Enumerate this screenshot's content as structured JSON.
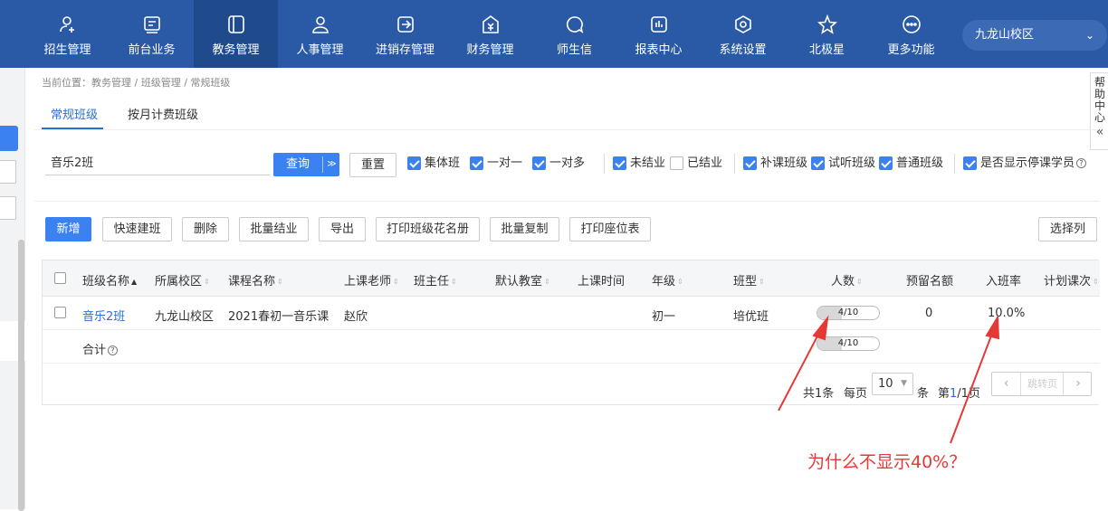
{
  "nav": {
    "items": [
      {
        "label": "招生管理",
        "icon": "user-plus-icon"
      },
      {
        "label": "前台业务",
        "icon": "reception-icon"
      },
      {
        "label": "教务管理",
        "icon": "book-icon"
      },
      {
        "label": "人事管理",
        "icon": "person-icon"
      },
      {
        "label": "进销存管理",
        "icon": "inventory-icon"
      },
      {
        "label": "财务管理",
        "icon": "finance-icon"
      },
      {
        "label": "师生信",
        "icon": "message-icon"
      },
      {
        "label": "报表中心",
        "icon": "report-icon"
      },
      {
        "label": "系统设置",
        "icon": "settings-icon"
      },
      {
        "label": "北极星",
        "icon": "star-icon"
      },
      {
        "label": "更多功能",
        "icon": "more-icon"
      }
    ],
    "active_index": 2,
    "campus": "九龙山校区"
  },
  "help": {
    "label": "帮助中心",
    "chars": [
      "帮",
      "助",
      "中",
      "心"
    ]
  },
  "breadcrumb": "当前位置：教务管理 / 班级管理 / 常规班级",
  "tabs": [
    {
      "label": "常规班级",
      "active": true
    },
    {
      "label": "按月计费班级",
      "active": false
    }
  ],
  "filters": {
    "search_value": "音乐2班",
    "query_label": "查询",
    "reset_label": "重置",
    "checks": [
      {
        "label": "集体班",
        "checked": true
      },
      {
        "label": "一对一",
        "checked": true
      },
      {
        "label": "一对多",
        "checked": true
      },
      {
        "label": "未结业",
        "checked": true
      },
      {
        "label": "已结业",
        "checked": false
      },
      {
        "label": "补课班级",
        "checked": true
      },
      {
        "label": "试听班级",
        "checked": true
      },
      {
        "label": "普通班级",
        "checked": true
      },
      {
        "label": "是否显示停课学员",
        "checked": true
      }
    ]
  },
  "toolbar": {
    "buttons": [
      "新增",
      "快速建班",
      "删除",
      "批量结业",
      "导出",
      "打印班级花名册",
      "批量复制",
      "打印座位表"
    ],
    "choose_columns": "选择列"
  },
  "table": {
    "columns": [
      "班级名称",
      "所属校区",
      "课程名称",
      "上课老师",
      "班主任",
      "默认教室",
      "上课时间",
      "年级",
      "班型",
      "人数",
      "预留名额",
      "入班率",
      "计划课次"
    ],
    "rows": [
      {
        "class_name": "音乐2班",
        "campus": "九龙山校区",
        "course": "2021春初一音乐课",
        "teacher": "赵欣",
        "head_teacher": "",
        "classroom": "",
        "time": "",
        "grade": "初一",
        "class_type": "培优班",
        "headcount": "4/10",
        "headcount_fraction": 0.4,
        "reserved": "0",
        "enroll_rate": "10.0%",
        "planned": ""
      }
    ],
    "total_label": "合计",
    "total_headcount": "4/10",
    "total_fraction": 0.4
  },
  "pager": {
    "total": "共1条",
    "per_page_label": "每页",
    "per_page": "10",
    "unit": "条",
    "page_prefix": "第",
    "page_current": "1",
    "page_rest": "/1页",
    "jump_placeholder": "跳转页"
  },
  "annotation": {
    "text": "为什么不显示40%？",
    "color": "#e53935"
  }
}
